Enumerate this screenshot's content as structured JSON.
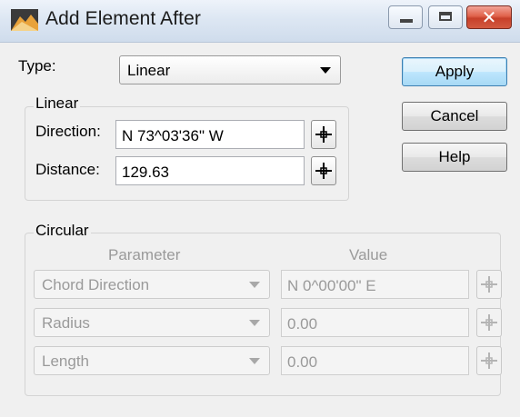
{
  "window": {
    "title": "Add Element After"
  },
  "type_field": {
    "label": "Type:",
    "value": "Linear"
  },
  "buttons": {
    "apply": "Apply",
    "cancel": "Cancel",
    "help": "Help"
  },
  "linear": {
    "group_title": "Linear",
    "direction_label": "Direction:",
    "direction_value": "N 73^03'36\" W",
    "distance_label": "Distance:",
    "distance_value": "129.63"
  },
  "circular": {
    "group_title": "Circular",
    "col_parameter": "Parameter",
    "col_value": "Value",
    "rows": [
      {
        "parameter": "Chord Direction",
        "value": "N  0^00'00\" E"
      },
      {
        "parameter": "Radius",
        "value": "0.00"
      },
      {
        "parameter": "Length",
        "value": "0.00"
      }
    ]
  },
  "colors": {
    "title_bar": "#dde7f3",
    "close_button": "#d35a40",
    "disabled_text": "#9a9a9a"
  }
}
